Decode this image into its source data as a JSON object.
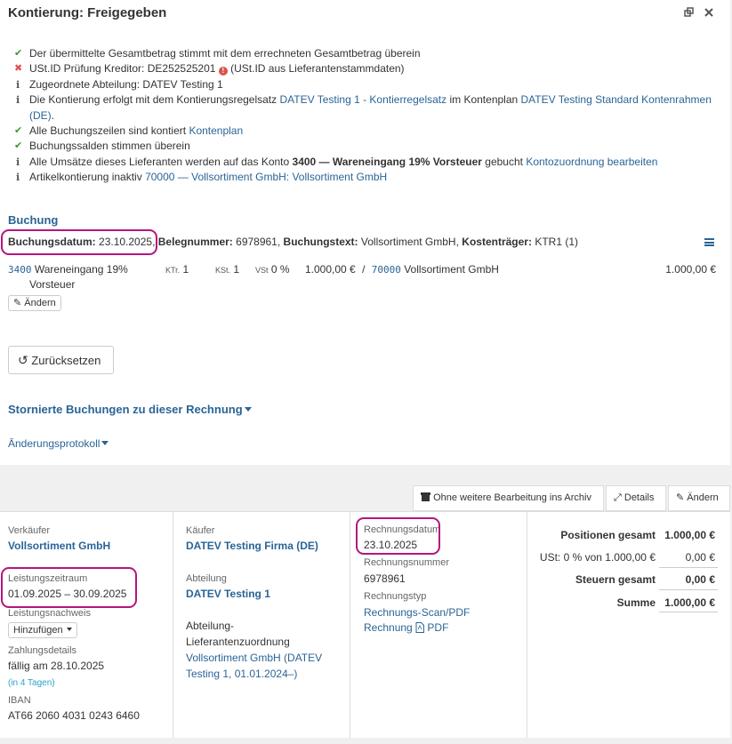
{
  "header": {
    "title": "Kontierung: Freigegeben"
  },
  "checks": [
    {
      "icon": "check-icon",
      "parts": [
        {
          "t": "Der übermittelte Gesamtbetrag stimmt mit dem errechneten Gesamtbetrag überein"
        }
      ]
    },
    {
      "icon": "cross-icon",
      "parts": [
        {
          "t": "USt.ID Prüfung Kreditor: DE252525201 "
        },
        {
          "t": "!",
          "excl": true
        },
        {
          "t": " (USt.ID aus Lieferantenstammdaten)"
        }
      ]
    },
    {
      "icon": "info-icon",
      "parts": [
        {
          "t": "Zugeordnete Abteilung: DATEV Testing 1"
        }
      ]
    },
    {
      "icon": "info-icon",
      "parts": [
        {
          "t": "Die Kontierung erfolgt mit dem Kontierungsregelsatz "
        },
        {
          "t": "DATEV Testing 1 - Kontierregelsatz",
          "link": true
        },
        {
          "t": " im Kontenplan "
        },
        {
          "t": "DATEV Testing Standard Kontenrahmen (DE)",
          "link": true
        },
        {
          "t": "."
        }
      ]
    },
    {
      "icon": "check-icon",
      "parts": [
        {
          "t": "Alle Buchungszeilen sind kontiert "
        },
        {
          "t": "Kontenplan",
          "link": true
        }
      ]
    },
    {
      "icon": "check-icon",
      "parts": [
        {
          "t": "Buchungssalden stimmen überein"
        }
      ]
    },
    {
      "icon": "info-icon",
      "parts": [
        {
          "t": "Alle Umsätze dieses Lieferanten werden auf das Konto "
        },
        {
          "t": "3400 — Wareneingang 19% Vorsteuer",
          "bold": true
        },
        {
          "t": " gebucht "
        },
        {
          "t": "Kontozuordnung bearbeiten",
          "link": true
        }
      ]
    },
    {
      "icon": "info-icon",
      "parts": [
        {
          "t": "Artikelkontierung inaktiv "
        },
        {
          "t": "70000 — Vollsortiment GmbH: Vollsortiment GmbH",
          "link": true
        }
      ]
    }
  ],
  "buchung": {
    "heading": "Buchung",
    "datum_label": "Buchungsdatum:",
    "datum": "23.10.2025,",
    "beleg_label": "Belegnummer:",
    "beleg": "6978961,",
    "text_label": "Buchungstext:",
    "text": "Vollsortiment GmbH,",
    "ktr_label": "Kostenträger:",
    "ktr": "KTR1 (1)",
    "line": {
      "account": "3400",
      "account_name": "Wareneingang 19%",
      "account_name2": "Vorsteuer",
      "ktr_label": "KTr.",
      "ktr": "1",
      "kst_label": "KSt.",
      "kst": "1",
      "vst_label": "VSt",
      "vst": "0 %",
      "amount": "1.000,00 €",
      "sep": "/",
      "contra": "70000",
      "contra_name": "Vollsortiment GmbH",
      "amount2": "1.000,00 €"
    },
    "edit_label": "Ändern",
    "reset_label": "Zurücksetzen"
  },
  "storniert_label": "Stornierte Buchungen zu dieser Rechnung",
  "protokoll_label": "Änderungsprotokoll",
  "actions": {
    "archive": "Ohne weitere Bearbeitung ins Archiv",
    "details": "Details",
    "edit": "Ändern"
  },
  "seller": {
    "label": "Verkäufer",
    "name": "Vollsortiment GmbH",
    "period_label": "Leistungszeitraum",
    "period": "01.09.2025 – 30.09.2025",
    "proof_label": "Leistungsnachweis",
    "proof_btn": "Hinzufügen",
    "pay_label": "Zahlungsdetails",
    "pay_due": "fällig am 28.10.2025",
    "pay_days": "(in 4 Tagen)",
    "iban_label": "IBAN",
    "iban": "AT66 2060 4031 0243 6460"
  },
  "buyer": {
    "label": "Käufer",
    "name": "DATEV Testing Firma (DE)",
    "dept_label": "Abteilung",
    "dept": "DATEV Testing 1",
    "assign_label1": "Abteilung-",
    "assign_label2": "Lieferantenzuordnung",
    "assign_link1": "Vollsortiment GmbH (DATEV",
    "assign_link2": "Testing 1, 01.01.2024–)"
  },
  "invoice": {
    "date_label": "Rechnungsdatum",
    "date": "23.10.2025",
    "num_label": "Rechnungsnummer",
    "num": "6978961",
    "type_label": "Rechnungstyp",
    "type_link": "Rechnungs-Scan/PDF",
    "pdf_link1": "Rechnung",
    "pdf_link2": "PDF"
  },
  "totals": {
    "pos_label": "Positionen gesamt",
    "pos": "1.000,00 €",
    "ust_label": "USt: 0 % von 1.000,00 €",
    "ust": "0,00 €",
    "tax_label": "Steuern gesamt",
    "tax": "0,00 €",
    "sum_label": "Summe",
    "sum": "1.000,00 €"
  },
  "colors": {
    "link": "#2a6496",
    "highlight": "#b5157f",
    "ok": "#3a9a2e",
    "error": "#d9534f"
  }
}
